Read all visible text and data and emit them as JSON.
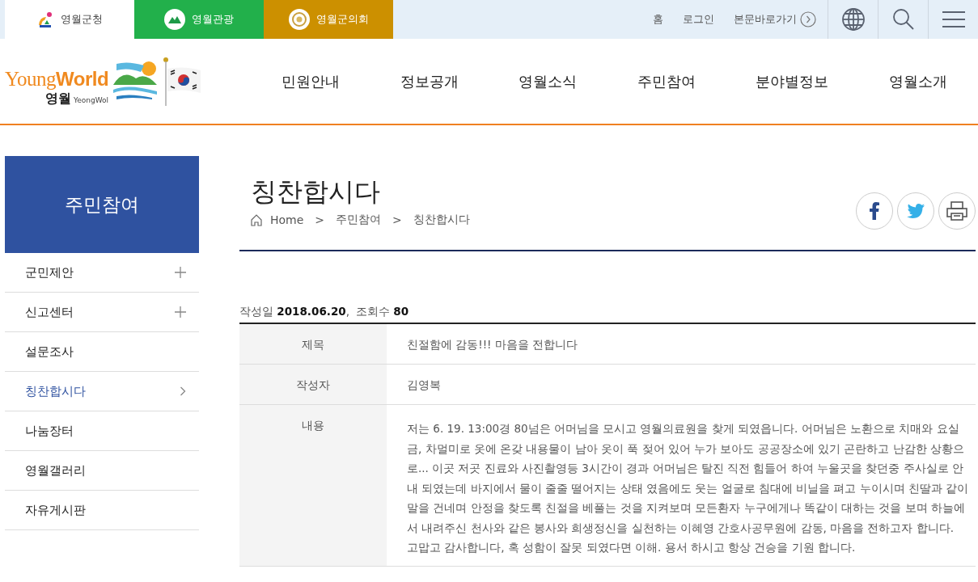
{
  "site_tabs": [
    {
      "label": "영월군청",
      "kind": "county",
      "selected": true
    },
    {
      "label": "영월관광",
      "kind": "tourism",
      "selected": false
    },
    {
      "label": "영월군의회",
      "kind": "council",
      "selected": false
    }
  ],
  "util_links": [
    "홈",
    "로그인",
    "본문바로가기"
  ],
  "logo": {
    "part_1": "Young",
    "part_2": "World",
    "korean": "영월",
    "roman": "YeongWol"
  },
  "nav": [
    "민원안내",
    "정보공개",
    "영월소식",
    "주민참여",
    "분야별정보",
    "영월소개"
  ],
  "sidebar": {
    "title": "주민참여",
    "items": [
      {
        "label": "군민제안",
        "expandable": true,
        "selected": false
      },
      {
        "label": "신고센터",
        "expandable": true,
        "selected": false
      },
      {
        "label": "설문조사",
        "expandable": false,
        "selected": false
      },
      {
        "label": "칭찬합시다",
        "expandable": false,
        "selected": true
      },
      {
        "label": "나눔장터",
        "expandable": false,
        "selected": false
      },
      {
        "label": "영월갤러리",
        "expandable": false,
        "selected": false
      },
      {
        "label": "자유게시판",
        "expandable": false,
        "selected": false
      }
    ]
  },
  "page": {
    "title": "칭찬합시다",
    "breadcrumb": [
      "Home",
      ">",
      "주민참여",
      ">",
      "칭찬합시다"
    ]
  },
  "meta": {
    "date_label": "작성일",
    "date": "2018.06.20",
    "separator": ",",
    "views_label": "조회수",
    "views": "80"
  },
  "post": [
    {
      "label": "제목",
      "value": [
        "친절함에 감동!!! 마음을 전합니다"
      ]
    },
    {
      "label": "작성자",
      "value": [
        "김영복"
      ]
    },
    {
      "label": "내용",
      "value": [
        "저는 6. 19. 13:00경 80넘은 어머님을 모시고 영월의료원을 찾게 되였읍니다. 어머님은 노환으로 치매와 요실금, 차멀미로 옷에 온갖 내용물이 남아 옷이 푹 젖어 있어 누가 보아도 공공장소에 있기 곤란하고 난감한 상황으로... 이곳 저곳 진료와 사진촬영등 3시간이 경과 어머님은 탈진 직전 힘들어 하여 누울곳을 찾던중 주사실로 안내 되였는데 바지에서 물이 줄줄 떨어지는 상태 였음에도 웃는 얼굴로 침대에 비닐을 펴고 누이시며 친딸과 같이 말을 건네며 안정을 찾도록 친절을 베풀는 것을 지켜보며 모든환자 누구에게나 똑같이 대하는 것을 보며 하늘에서 내려주신 천사와 같은 봉사와 희생정신을 실천하는 이혜영 간호사공무원에 감동, 마음을 전하고자 합니다.",
        "고맙고 감사합니다, 혹 성함이 잘못 되였다면 이해. 용서 하시고 항상 건승을 기원 합니다."
      ]
    }
  ]
}
